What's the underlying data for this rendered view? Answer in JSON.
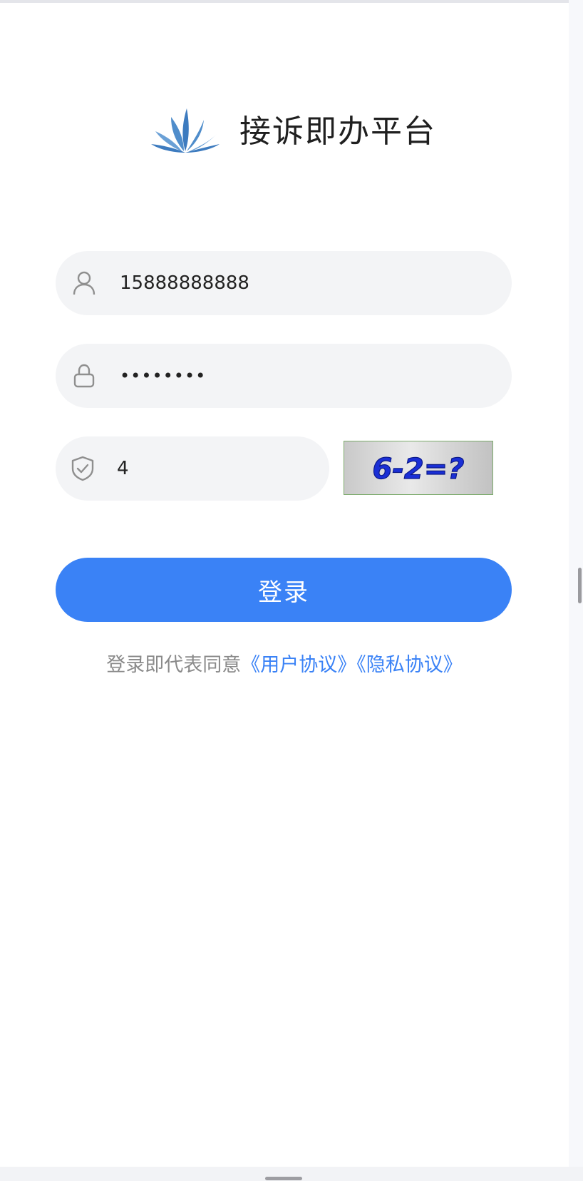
{
  "app": {
    "title": "接诉即办平台",
    "logo_icon": "lotus-logo-icon"
  },
  "form": {
    "username": {
      "value": "15888888888",
      "icon": "user-icon"
    },
    "password": {
      "value": "12345678",
      "icon": "lock-icon"
    },
    "captcha": {
      "value": "4",
      "icon": "shield-check-icon",
      "image_text": "6-2=?"
    },
    "login_label": "登录"
  },
  "agreement": {
    "prefix": "登录即代表同意",
    "user_agreement": "《用户协议》",
    "privacy_policy": "《隐私协议》"
  },
  "colors": {
    "primary": "#3a82f6",
    "input_bg": "#f3f4f6",
    "icon_gray": "#8f8f8f",
    "captcha_text": "#1a2fd6",
    "captcha_border": "#7cab6c",
    "logo_blue": "#3d7bbf"
  }
}
